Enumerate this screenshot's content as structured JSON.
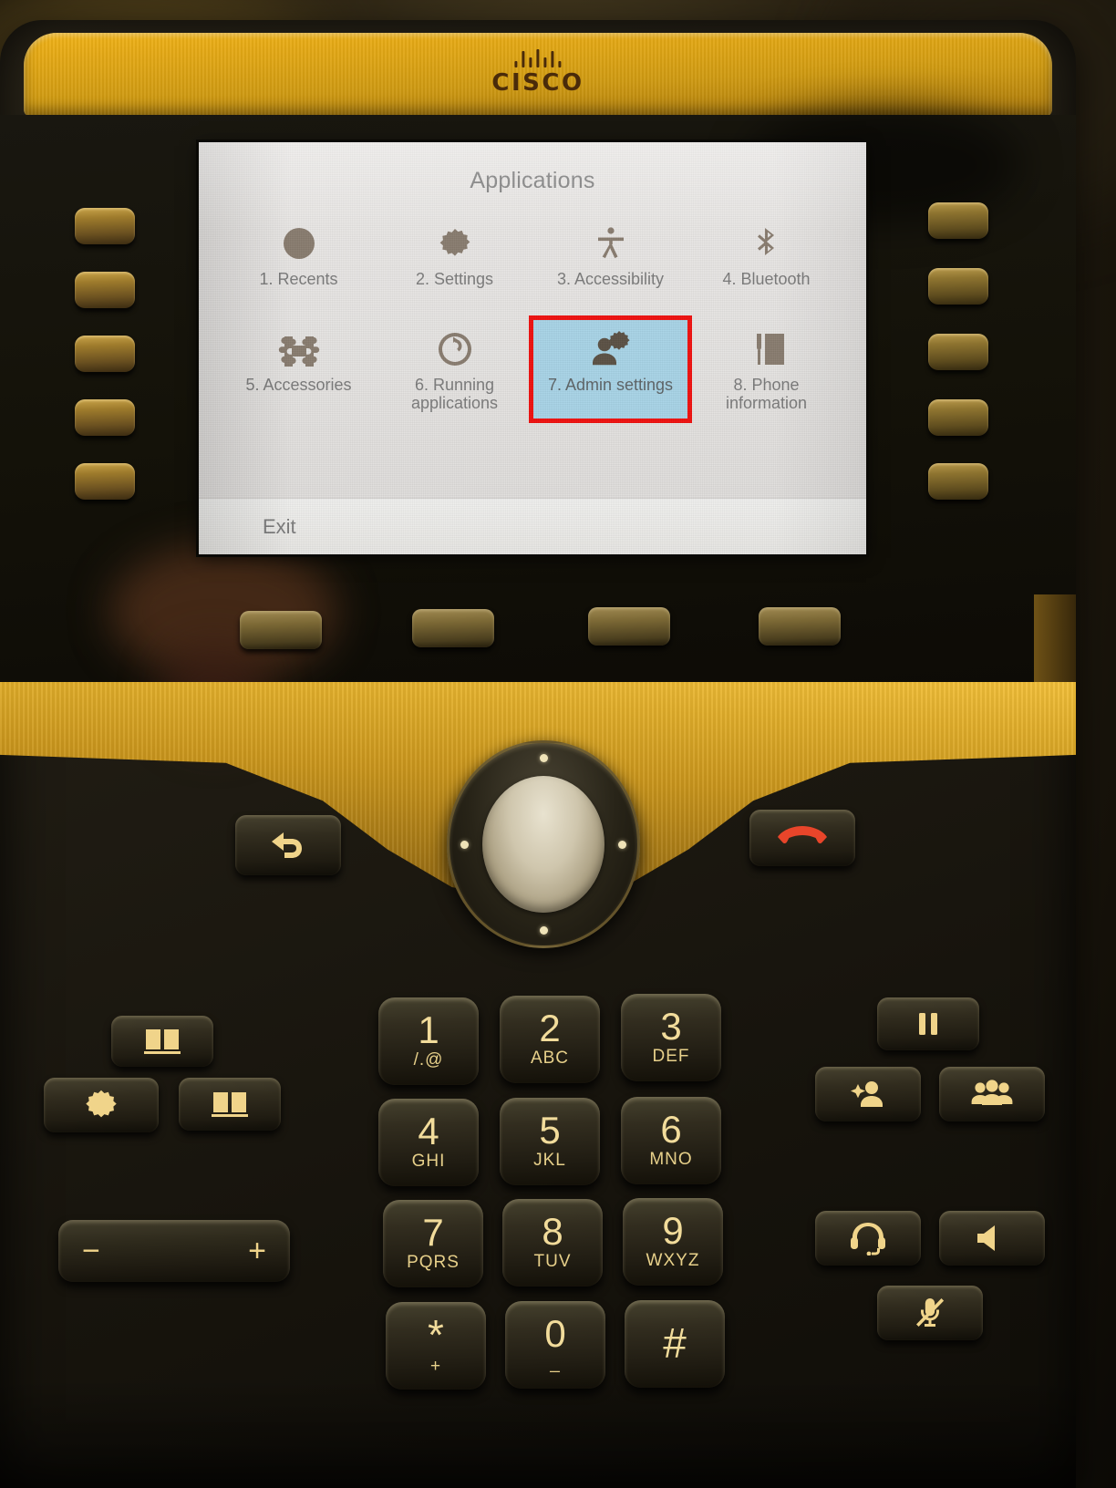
{
  "device": {
    "brand": "CISCO",
    "brand_logo_name": "cisco-bridge-logo"
  },
  "screen": {
    "title": "Applications",
    "apps": [
      {
        "index": "1.",
        "label": "1. Recents",
        "icon": "clock-icon",
        "selected": false
      },
      {
        "index": "2.",
        "label": "2. Settings",
        "icon": "gear-icon",
        "selected": false
      },
      {
        "index": "3.",
        "label": "3. Accessibility",
        "icon": "accessibility-icon",
        "selected": false
      },
      {
        "index": "4.",
        "label": "4. Bluetooth",
        "icon": "bluetooth-icon",
        "selected": false
      },
      {
        "index": "5.",
        "label": "5. Accessories",
        "icon": "puzzle-piece-icon",
        "selected": false
      },
      {
        "index": "6.",
        "label": "6. Running applications",
        "icon": "refresh-circle-icon",
        "selected": false
      },
      {
        "index": "7.",
        "label": "7. Admin settings",
        "icon": "user-gear-icon",
        "selected": true
      },
      {
        "index": "8.",
        "label": "8. Phone information",
        "icon": "phone-info-icon",
        "selected": false
      }
    ],
    "softkeys": [
      "Exit",
      "",
      "",
      ""
    ],
    "highlight_color": "#a9d5e8",
    "annotation_color": "#f2110f",
    "text_color": "#7c7c7c",
    "background_color": "#e9e9e7"
  },
  "keypad": [
    {
      "num": "1",
      "sub": "/.@"
    },
    {
      "num": "2",
      "sub": "ABC"
    },
    {
      "num": "3",
      "sub": "DEF"
    },
    {
      "num": "4",
      "sub": "GHI"
    },
    {
      "num": "5",
      "sub": "JKL"
    },
    {
      "num": "6",
      "sub": "MNO"
    },
    {
      "num": "7",
      "sub": "PQRS"
    },
    {
      "num": "8",
      "sub": "TUV"
    },
    {
      "num": "9",
      "sub": "WXYZ"
    },
    {
      "num": "*",
      "sub": "+"
    },
    {
      "num": "0",
      "sub": "_"
    },
    {
      "num": "#",
      "sub": ""
    }
  ],
  "feature_buttons": {
    "messages": "messages-icon",
    "applications": "applications-gear-icon",
    "directory": "directory-icon",
    "hold": "hold-icon",
    "transfer": "transfer-icon",
    "conference": "conference-icon",
    "headset": "headset-icon",
    "speakerphone": "speakerphone-icon",
    "mute": "mute-icon",
    "back": "back-icon",
    "end_call": "end-call-icon",
    "select": "select-button"
  },
  "volume": {
    "minus": "−",
    "plus": "+"
  },
  "line_buttons": {
    "left_count": 5,
    "right_count": 5
  },
  "colors": {
    "bezel_gold": "#e5a915",
    "body_dark": "#211d14",
    "key_text": "#f2dc9b",
    "end_call_red": "#e8452a"
  }
}
